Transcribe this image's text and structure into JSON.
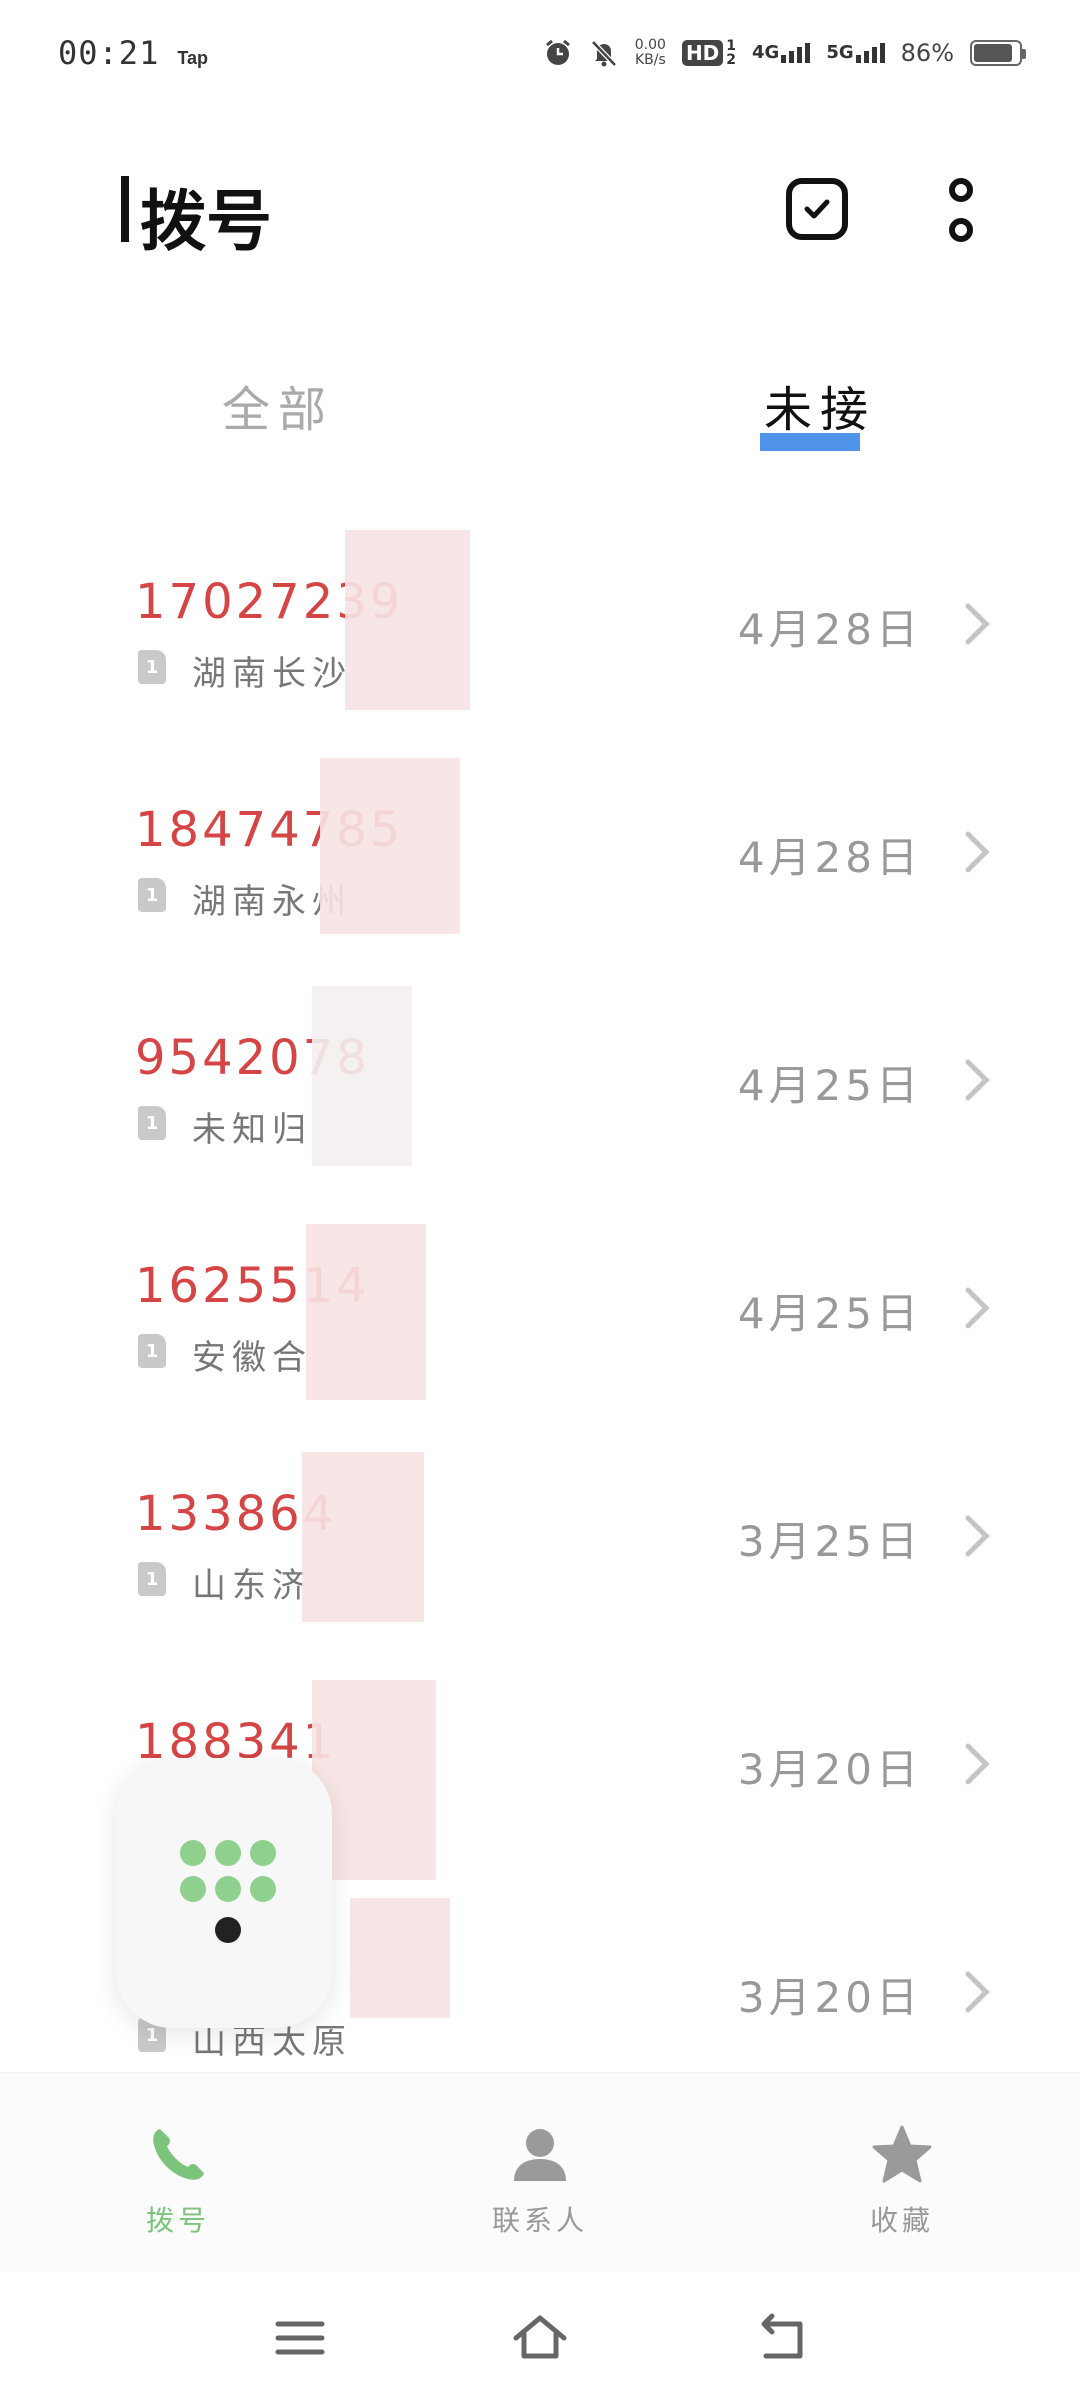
{
  "status_bar": {
    "time": "00:21",
    "carrier_tag": "Tap",
    "net_speed_value": "0.00",
    "net_speed_unit": "KB/s",
    "hd_label": "HD",
    "sim_top": "1",
    "sim_bottom": "2",
    "net1": "4G",
    "net2": "5G",
    "battery_percent": "86%",
    "battery_level": 0.86
  },
  "header": {
    "title": "拨号",
    "select_icon": "checkbox-icon",
    "more_icon": "more-vertical-icon"
  },
  "tabs": [
    {
      "label": "全部",
      "active": false
    },
    {
      "label": "未接",
      "active": true
    }
  ],
  "colors": {
    "accent": "#4f93ea",
    "missed_number": "#d64545",
    "nav_active": "#7cc47c",
    "muted": "#999999"
  },
  "calls": [
    {
      "number": "17027239",
      "sim": "1",
      "location": "湖南长沙",
      "date": "4月28日"
    },
    {
      "number": "18474785",
      "sim": "1",
      "location": "湖南永州",
      "date": "4月28日"
    },
    {
      "number": "9542078",
      "sim": "1",
      "location": "未知归",
      "date": "4月25日"
    },
    {
      "number": "1625514",
      "sim": "1",
      "location": "安徽合",
      "date": "4月25日"
    },
    {
      "number": "133864",
      "sim": "1",
      "location": "山东济",
      "date": "3月25日"
    },
    {
      "number": "188341",
      "sim": "1",
      "location": "",
      "date": "3月20日"
    },
    {
      "number": "",
      "sim": "1",
      "location": "山西太原",
      "date": "3月20日"
    }
  ],
  "bottom_nav": [
    {
      "label": "拨号",
      "icon": "phone-icon",
      "active": true
    },
    {
      "label": "联系人",
      "icon": "person-icon",
      "active": false
    },
    {
      "label": "收藏",
      "icon": "star-icon",
      "active": false
    }
  ],
  "system_nav": [
    "menu-icon",
    "home-icon",
    "back-icon"
  ]
}
